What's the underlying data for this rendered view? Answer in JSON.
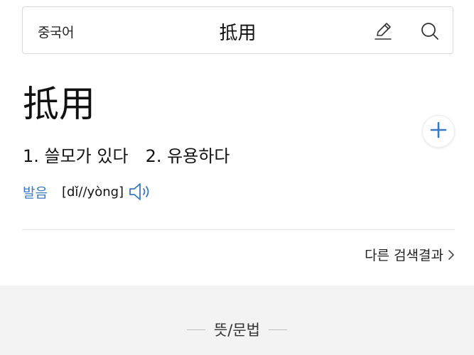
{
  "search": {
    "language": "중국어",
    "term": "抵用"
  },
  "entry": {
    "headword": "抵用",
    "meanings": [
      "1. 쓸모가 있다",
      "2. 유용하다"
    ],
    "pronunciation_label": "발음",
    "pronunciation": "[dǐ//yòng]"
  },
  "links": {
    "more_results": "다른 검색결과"
  },
  "section": {
    "title": "뜻/문법"
  },
  "icons": {
    "edit": "pencil-icon",
    "search": "magnifier-icon",
    "add": "plus-icon",
    "speaker": "speaker-icon",
    "chevron": "chevron-right-icon"
  },
  "colors": {
    "accent": "#3b78c2",
    "gray_bg": "#f3f3f3"
  }
}
